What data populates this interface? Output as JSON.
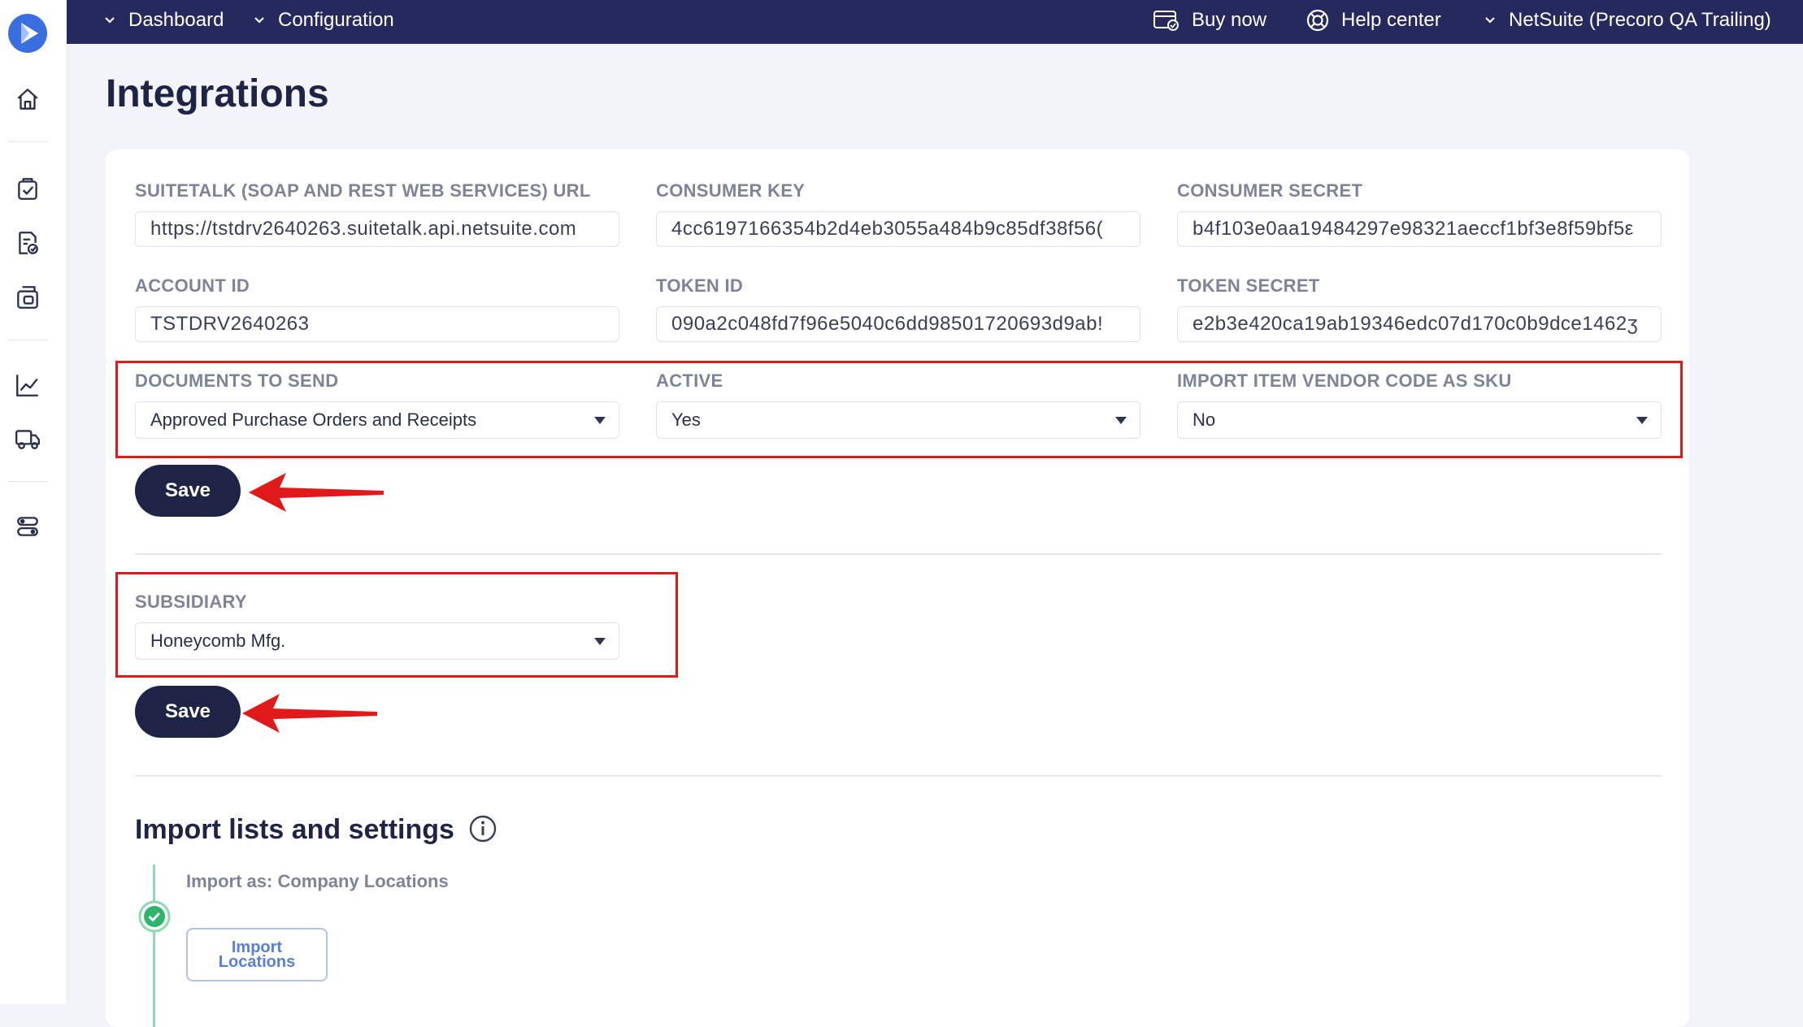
{
  "topbar": {
    "dashboard_label": "Dashboard",
    "configuration_label": "Configuration",
    "buy_now_label": "Buy now",
    "help_center_label": "Help center",
    "account_label": "NetSuite (Precoro QA Trailing)"
  },
  "page": {
    "title": "Integrations"
  },
  "credentials": {
    "suitetalk_label": "SUITETALK (SOAP AND REST WEB SERVICES) URL",
    "suitetalk_value": "https://tstdrv2640263.suitetalk.api.netsuite.com",
    "consumer_key_label": "CONSUMER KEY",
    "consumer_key_value": "4cc6197166354b2d4eb3055a484b9c85df38f56(",
    "consumer_secret_label": "CONSUMER SECRET",
    "consumer_secret_value": "b4f103e0aa19484297e98321aeccf1bf3e8f59bf5ε",
    "account_id_label": "ACCOUNT ID",
    "account_id_value": "TSTDRV2640263",
    "token_id_label": "TOKEN ID",
    "token_id_value": "090a2c048fd7f96e5040c6dd98501720693d9ab!",
    "token_secret_label": "TOKEN SECRET",
    "token_secret_value": "e2b3e420ca19ab19346edc07d170c0b9dce1462ʒ"
  },
  "settings": {
    "documents_label": "DOCUMENTS TO SEND",
    "documents_value": "Approved Purchase Orders and Receipts",
    "active_label": "ACTIVE",
    "active_value": "Yes",
    "import_sku_label": "IMPORT ITEM VENDOR CODE AS SKU",
    "import_sku_value": "No",
    "save_label": "Save"
  },
  "subsidiary": {
    "label": "SUBSIDIARY",
    "value": "Honeycomb Mfg.",
    "save_label": "Save"
  },
  "import_section": {
    "title": "Import lists and settings",
    "step_label": "Import as: Company Locations",
    "button_line1": "Import",
    "button_line2": "Locations"
  },
  "colors": {
    "topbar": "#26295e",
    "primary_button": "#1f2447",
    "annotation_red": "#e01a1a",
    "success_green": "#2fb56a"
  },
  "icons": [
    "logo-icon",
    "home-icon",
    "purchase-order-icon",
    "invoice-icon",
    "receipt-icon",
    "analytics-icon",
    "delivery-icon",
    "settings-icon",
    "chevron-down-icon",
    "buy-now-icon",
    "help-center-icon",
    "info-icon",
    "check-icon"
  ]
}
